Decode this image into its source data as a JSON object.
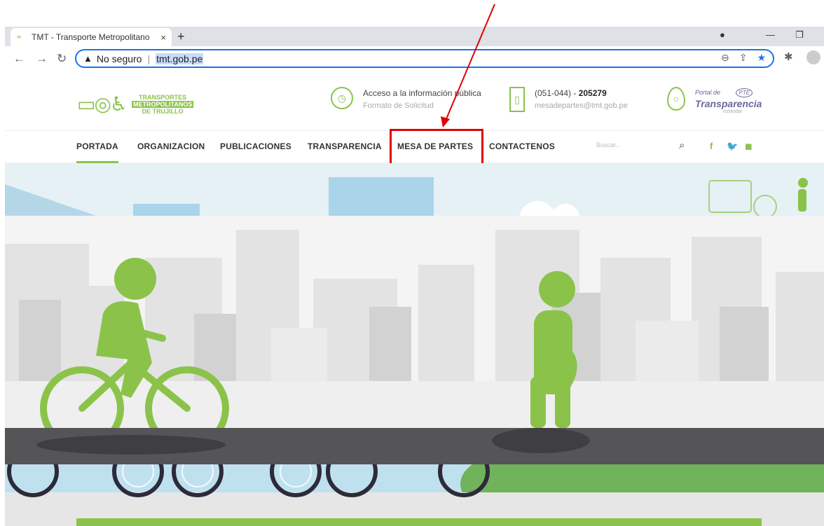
{
  "browser": {
    "tab_title": "TMT - Transporte Metropolitano",
    "tab_close": "×",
    "new_tab": "+",
    "security_label": "No seguro",
    "url": "tmt.gob.pe"
  },
  "header": {
    "logo": {
      "line1": "TRANSPORTES",
      "line2": "METROPOLITANOS",
      "line3": "DE TRUJILLO"
    },
    "info_access": {
      "title": "Acceso a la información pública",
      "subtitle": "Formato de Solicitud"
    },
    "info_phone": {
      "prefix": "(051-044) - ",
      "number": "205279",
      "email": "mesadepartes@tmt.gob.pe"
    },
    "transparency": {
      "small": "Portal de",
      "large": "Transparencia",
      "tiny": "estándar",
      "badge": "PTE"
    }
  },
  "nav": {
    "items": [
      {
        "label": "PORTADA"
      },
      {
        "label": "ORGANIZACION"
      },
      {
        "label": "PUBLICACIONES"
      },
      {
        "label": "TRANSPARENCIA"
      },
      {
        "label": "MESA DE PARTES"
      },
      {
        "label": "CONTACTENOS"
      }
    ],
    "search_placeholder": "Buscar...",
    "social": [
      "f",
      "🐦",
      "◼"
    ]
  },
  "colors": {
    "brand_green": "#8bc34a",
    "annotation_red": "#e00000",
    "focus_blue": "#1a73e8"
  }
}
